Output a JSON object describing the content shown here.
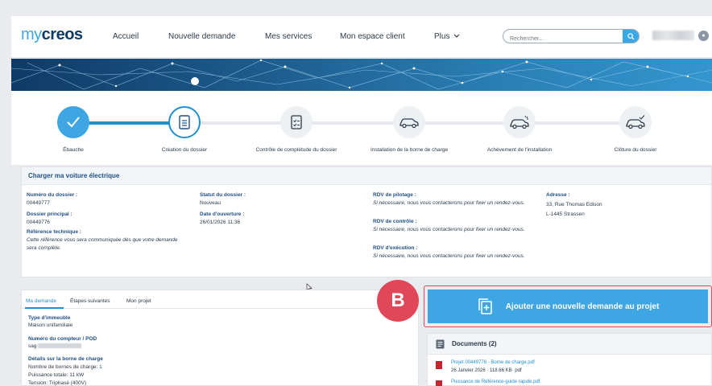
{
  "nav": {
    "logo_my": "my",
    "logo_creos": "creos",
    "items": [
      "Accueil",
      "Nouvelle demande",
      "Mes services",
      "Mon espace client",
      "Plus"
    ],
    "search_placeholder": "Rechercher..."
  },
  "steps": [
    {
      "label": "Ébauche",
      "state": "done"
    },
    {
      "label": "Création du dossier",
      "state": "active"
    },
    {
      "label": "Contrôle de complétude du dossier",
      "state": "todo"
    },
    {
      "label": "Installation de la borne de charge",
      "state": "todo"
    },
    {
      "label": "Achèvement de l'installation",
      "state": "todo"
    },
    {
      "label": "Clôture du dossier",
      "state": "todo"
    }
  ],
  "info": {
    "title": "Charger ma voiture électrique",
    "numero_label": "Numéro du dossier :",
    "numero_value": "00449777",
    "principal_label": "Dossier principal :",
    "principal_value": "00449776",
    "reference_label": "Référence technique :",
    "reference_text": "Cette référence vous sera communiquée dès que votre demande sera complète.",
    "statut_label": "Statut du dossier :",
    "statut_value": "Nouveau",
    "ouverture_label": "Date d'ouverture :",
    "ouverture_value": "26/01/2026 11:36",
    "pilotage_label": "RDV de pilotage :",
    "pilotage_text": "Si nécessaire, nous vous contacterons pour fixer un rendez-vous.",
    "controle_label": "RDV de contrôle :",
    "controle_text": "Si nécessaire, nous vous contacterons pour fixer un rendez-vous.",
    "execution_label": "RDV d'exécution :",
    "execution_text": "Si nécessaire, nous vous contacterons pour fixer un rendez-vous.",
    "adresse_label": "Adresse :",
    "adresse_line1": "33, Rue Thomas Edison",
    "adresse_line2": "L-1445 Strassen"
  },
  "tabs": [
    "Ma demande",
    "Étapes suivantes",
    "Mon projet"
  ],
  "demande": {
    "immeuble_label": "Type d'immeuble",
    "immeuble_value": "Maison unifamiliale",
    "compteur_label": "Numéro du compteur / POD",
    "compteur_value": "sag",
    "borne_label": "Détails sur la borne de charge",
    "nb_bornes_label": "Nombre de bornes de charge:",
    "nb_bornes_value": "1",
    "puissance": "Puissance totale: 11 kW",
    "tension": "Tension: Triphasé (400V)"
  },
  "badge": "B",
  "add_button": "Ajouter une nouvelle demande au projet",
  "documents": {
    "title": "Documents (2)",
    "items": [
      {
        "name": "Projet 00449776 - Borne de charge.pdf",
        "meta": "26 Janvier 2026 · 118.66 KB· pdf"
      },
      {
        "name": "Puissance de Référence-guide rapide.pdf"
      }
    ]
  },
  "colors": {
    "accent": "#3ea6e3",
    "brand_dark": "#0f3a66",
    "highlight": "#e0485a"
  }
}
